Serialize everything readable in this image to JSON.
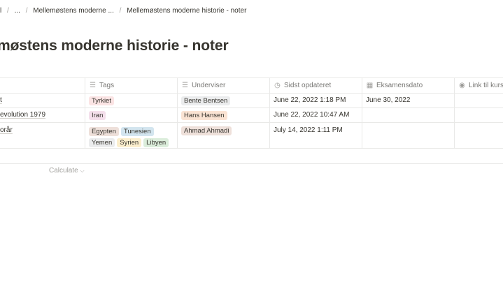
{
  "breadcrumb": {
    "root": "l",
    "ellipsis": "...",
    "parent": "Mellemøstens moderne ...",
    "current": "Mellemøstens moderne historie - noter"
  },
  "page": {
    "title": "møstens moderne historie - noter"
  },
  "columns": {
    "tags": "Tags",
    "instructor": "Underviser",
    "updated": "Sidst opdateret",
    "exam": "Eksamensdato",
    "link": "Link til kursu"
  },
  "rows": [
    {
      "name": "t",
      "tags": [
        {
          "label": "Tyrkiet",
          "color": "#fbe4e4"
        }
      ],
      "instructor": {
        "label": "Bente Bentsen",
        "color": "#ebeced"
      },
      "updated": "June 22, 2022 1:18 PM",
      "exam": "June 30, 2022"
    },
    {
      "name": "evolution 1979",
      "tags": [
        {
          "label": "Iran",
          "color": "#f4dfeb"
        }
      ],
      "instructor": {
        "label": "Hans Hansen",
        "color": "#fae3d3"
      },
      "updated": "June 22, 2022 10:47 AM",
      "exam": ""
    },
    {
      "name": "orår",
      "tags": [
        {
          "label": "Egypten",
          "color": "#eee0da"
        },
        {
          "label": "Tunesien",
          "color": "#d3e5ef"
        },
        {
          "label": "Yemen",
          "color": "#ebeced"
        },
        {
          "label": "Syrien",
          "color": "#fbeecd"
        },
        {
          "label": "Libyen",
          "color": "#dbeddb"
        }
      ],
      "instructor": {
        "label": "Ahmad Ahmadi",
        "color": "#eee0da"
      },
      "updated": "July 14, 2022 1:11 PM",
      "exam": ""
    }
  ],
  "footer": {
    "calculate": "Calculate",
    "chevron": "chevron-down-icon"
  }
}
